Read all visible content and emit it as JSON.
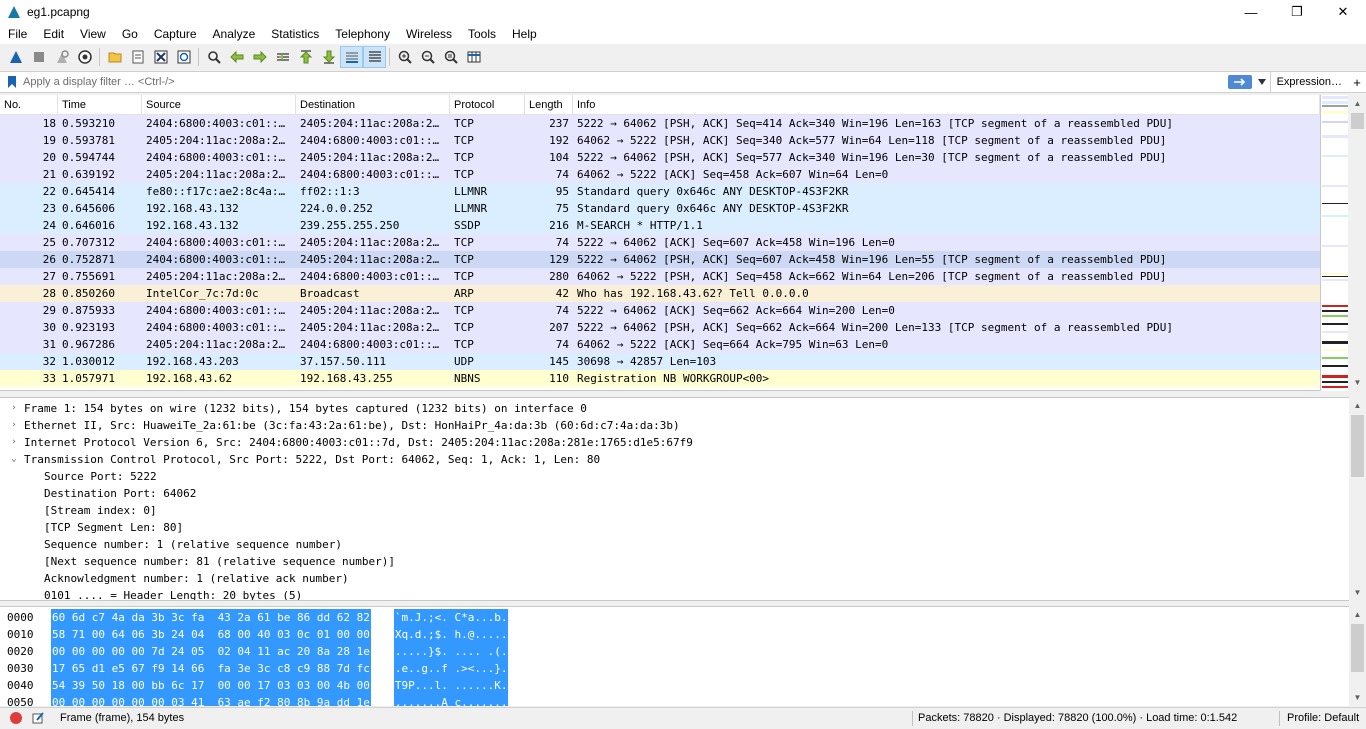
{
  "window": {
    "title": "eg1.pcapng",
    "minimize": "—",
    "maximize": "❐",
    "close": "✕"
  },
  "menu": [
    "File",
    "Edit",
    "View",
    "Go",
    "Capture",
    "Analyze",
    "Statistics",
    "Telephony",
    "Wireless",
    "Tools",
    "Help"
  ],
  "filter": {
    "placeholder": "Apply a display filter … <Ctrl-/>",
    "expression_label": "Expression…",
    "add_label": "+"
  },
  "packet_list": {
    "columns": [
      "No.",
      "Time",
      "Source",
      "Destination",
      "Protocol",
      "Length",
      "Info"
    ],
    "rows": [
      {
        "no": "18",
        "time": "0.593210",
        "src": "2404:6800:4003:c01::…",
        "dst": "2405:204:11ac:208a:2…",
        "proto": "TCP",
        "len": "237",
        "info": "5222 → 64062 [PSH, ACK] Seq=414 Ack=340 Win=196 Len=163 [TCP segment of a reassembled PDU]",
        "color": "#e7e6ff"
      },
      {
        "no": "19",
        "time": "0.593781",
        "src": "2405:204:11ac:208a:2…",
        "dst": "2404:6800:4003:c01::…",
        "proto": "TCP",
        "len": "192",
        "info": "64062 → 5222 [PSH, ACK] Seq=340 Ack=577 Win=64 Len=118 [TCP segment of a reassembled PDU]",
        "color": "#e7e6ff"
      },
      {
        "no": "20",
        "time": "0.594744",
        "src": "2404:6800:4003:c01::…",
        "dst": "2405:204:11ac:208a:2…",
        "proto": "TCP",
        "len": "104",
        "info": "5222 → 64062 [PSH, ACK] Seq=577 Ack=340 Win=196 Len=30 [TCP segment of a reassembled PDU]",
        "color": "#e7e6ff"
      },
      {
        "no": "21",
        "time": "0.639192",
        "src": "2405:204:11ac:208a:2…",
        "dst": "2404:6800:4003:c01::…",
        "proto": "TCP",
        "len": "74",
        "info": "64062 → 5222 [ACK] Seq=458 Ack=607 Win=64 Len=0",
        "color": "#e7e6ff"
      },
      {
        "no": "22",
        "time": "0.645414",
        "src": "fe80::f17c:ae2:8c4a:…",
        "dst": "ff02::1:3",
        "proto": "LLMNR",
        "len": "95",
        "info": "Standard query 0x646c ANY DESKTOP-4S3F2KR",
        "color": "#daeeff"
      },
      {
        "no": "23",
        "time": "0.645606",
        "src": "192.168.43.132",
        "dst": "224.0.0.252",
        "proto": "LLMNR",
        "len": "75",
        "info": "Standard query 0x646c ANY DESKTOP-4S3F2KR",
        "color": "#daeeff"
      },
      {
        "no": "24",
        "time": "0.646016",
        "src": "192.168.43.132",
        "dst": "239.255.255.250",
        "proto": "SSDP",
        "len": "216",
        "info": "M-SEARCH * HTTP/1.1",
        "color": "#daeeff"
      },
      {
        "no": "25",
        "time": "0.707312",
        "src": "2404:6800:4003:c01::…",
        "dst": "2405:204:11ac:208a:2…",
        "proto": "TCP",
        "len": "74",
        "info": "5222 → 64062 [ACK] Seq=607 Ack=458 Win=196 Len=0",
        "color": "#e7e6ff"
      },
      {
        "no": "26",
        "time": "0.752871",
        "src": "2404:6800:4003:c01::…",
        "dst": "2405:204:11ac:208a:2…",
        "proto": "TCP",
        "len": "129",
        "info": "5222 → 64062 [PSH, ACK] Seq=607 Ack=458 Win=196 Len=55 [TCP segment of a reassembled PDU]",
        "color": "#cdd9f4"
      },
      {
        "no": "27",
        "time": "0.755691",
        "src": "2405:204:11ac:208a:2…",
        "dst": "2404:6800:4003:c01::…",
        "proto": "TCP",
        "len": "280",
        "info": "64062 → 5222 [PSH, ACK] Seq=458 Ack=662 Win=64 Len=206 [TCP segment of a reassembled PDU]",
        "color": "#e7e6ff"
      },
      {
        "no": "28",
        "time": "0.850260",
        "src": "IntelCor_7c:7d:0c",
        "dst": "Broadcast",
        "proto": "ARP",
        "len": "42",
        "info": "Who has 192.168.43.62? Tell 0.0.0.0",
        "color": "#faf0d7"
      },
      {
        "no": "29",
        "time": "0.875933",
        "src": "2404:6800:4003:c01::…",
        "dst": "2405:204:11ac:208a:2…",
        "proto": "TCP",
        "len": "74",
        "info": "5222 → 64062 [ACK] Seq=662 Ack=664 Win=200 Len=0",
        "color": "#e7e6ff"
      },
      {
        "no": "30",
        "time": "0.923193",
        "src": "2404:6800:4003:c01::…",
        "dst": "2405:204:11ac:208a:2…",
        "proto": "TCP",
        "len": "207",
        "info": "5222 → 64062 [PSH, ACK] Seq=662 Ack=664 Win=200 Len=133 [TCP segment of a reassembled PDU]",
        "color": "#e7e6ff"
      },
      {
        "no": "31",
        "time": "0.967286",
        "src": "2405:204:11ac:208a:2…",
        "dst": "2404:6800:4003:c01::…",
        "proto": "TCP",
        "len": "74",
        "info": "64062 → 5222 [ACK] Seq=664 Ack=795 Win=63 Len=0",
        "color": "#e7e6ff"
      },
      {
        "no": "32",
        "time": "1.030012",
        "src": "192.168.43.203",
        "dst": "37.157.50.111",
        "proto": "UDP",
        "len": "145",
        "info": "30698 → 42857 Len=103",
        "color": "#daeeff"
      },
      {
        "no": "33",
        "time": "1.057971",
        "src": "192.168.43.62",
        "dst": "192.168.43.255",
        "proto": "NBNS",
        "len": "110",
        "info": "Registration NB WORKGROUP<00>",
        "color": "#fefed0"
      }
    ]
  },
  "details": [
    {
      "text": "Frame 1: 154 bytes on wire (1232 bits), 154 bytes captured (1232 bits) on interface 0",
      "expander": "›",
      "child": false
    },
    {
      "text": "Ethernet II, Src: HuaweiTe_2a:61:be (3c:fa:43:2a:61:be), Dst: HonHaiPr_4a:da:3b (60:6d:c7:4a:da:3b)",
      "expander": "›",
      "child": false
    },
    {
      "text": "Internet Protocol Version 6, Src: 2404:6800:4003:c01::7d, Dst: 2405:204:11ac:208a:281e:1765:d1e5:67f9",
      "expander": "›",
      "child": false
    },
    {
      "text": "Transmission Control Protocol, Src Port: 5222, Dst Port: 64062, Seq: 1, Ack: 1, Len: 80",
      "expander": "⌄",
      "child": false
    },
    {
      "text": "Source Port: 5222",
      "expander": "",
      "child": true
    },
    {
      "text": "Destination Port: 64062",
      "expander": "",
      "child": true
    },
    {
      "text": "[Stream index: 0]",
      "expander": "",
      "child": true
    },
    {
      "text": "[TCP Segment Len: 80]",
      "expander": "",
      "child": true
    },
    {
      "text": "Sequence number: 1    (relative sequence number)",
      "expander": "",
      "child": true
    },
    {
      "text": "[Next sequence number: 81    (relative sequence number)]",
      "expander": "",
      "child": true
    },
    {
      "text": "Acknowledgment number: 1    (relative ack number)",
      "expander": "",
      "child": true
    },
    {
      "text": "0101 .... = Header Length: 20 bytes (5)",
      "expander": "",
      "child": true
    }
  ],
  "bytes": [
    {
      "offset": "0000",
      "hex": "60 6d c7 4a da 3b 3c fa  43 2a 61 be 86 dd 62 82",
      "ascii": "`m.J.;<. C*a...b."
    },
    {
      "offset": "0010",
      "hex": "58 71 00 64 06 3b 24 04  68 00 40 03 0c 01 00 00",
      "ascii": "Xq.d.;$. h.@....."
    },
    {
      "offset": "0020",
      "hex": "00 00 00 00 00 7d 24 05  02 04 11 ac 20 8a 28 1e",
      "ascii": ".....}$. .... .(."
    },
    {
      "offset": "0030",
      "hex": "17 65 d1 e5 67 f9 14 66  fa 3e 3c c8 c9 88 7d fc",
      "ascii": ".e..g..f .><...}."
    },
    {
      "offset": "0040",
      "hex": "54 39 50 18 00 bb 6c 17  00 00 17 03 03 00 4b 00",
      "ascii": "T9P...l. ......K."
    },
    {
      "offset": "0050",
      "hex": "00 00 00 00 00 00 03 41  63 ae f2 80 8b 9a dd 1e",
      "ascii": ".......A c......."
    }
  ],
  "status": {
    "frame": "Frame (frame), 154 bytes",
    "packets": "Packets: 78820 · Displayed: 78820 (100.0%) · Load time: 0:1.542",
    "profile": "Profile: Default"
  }
}
